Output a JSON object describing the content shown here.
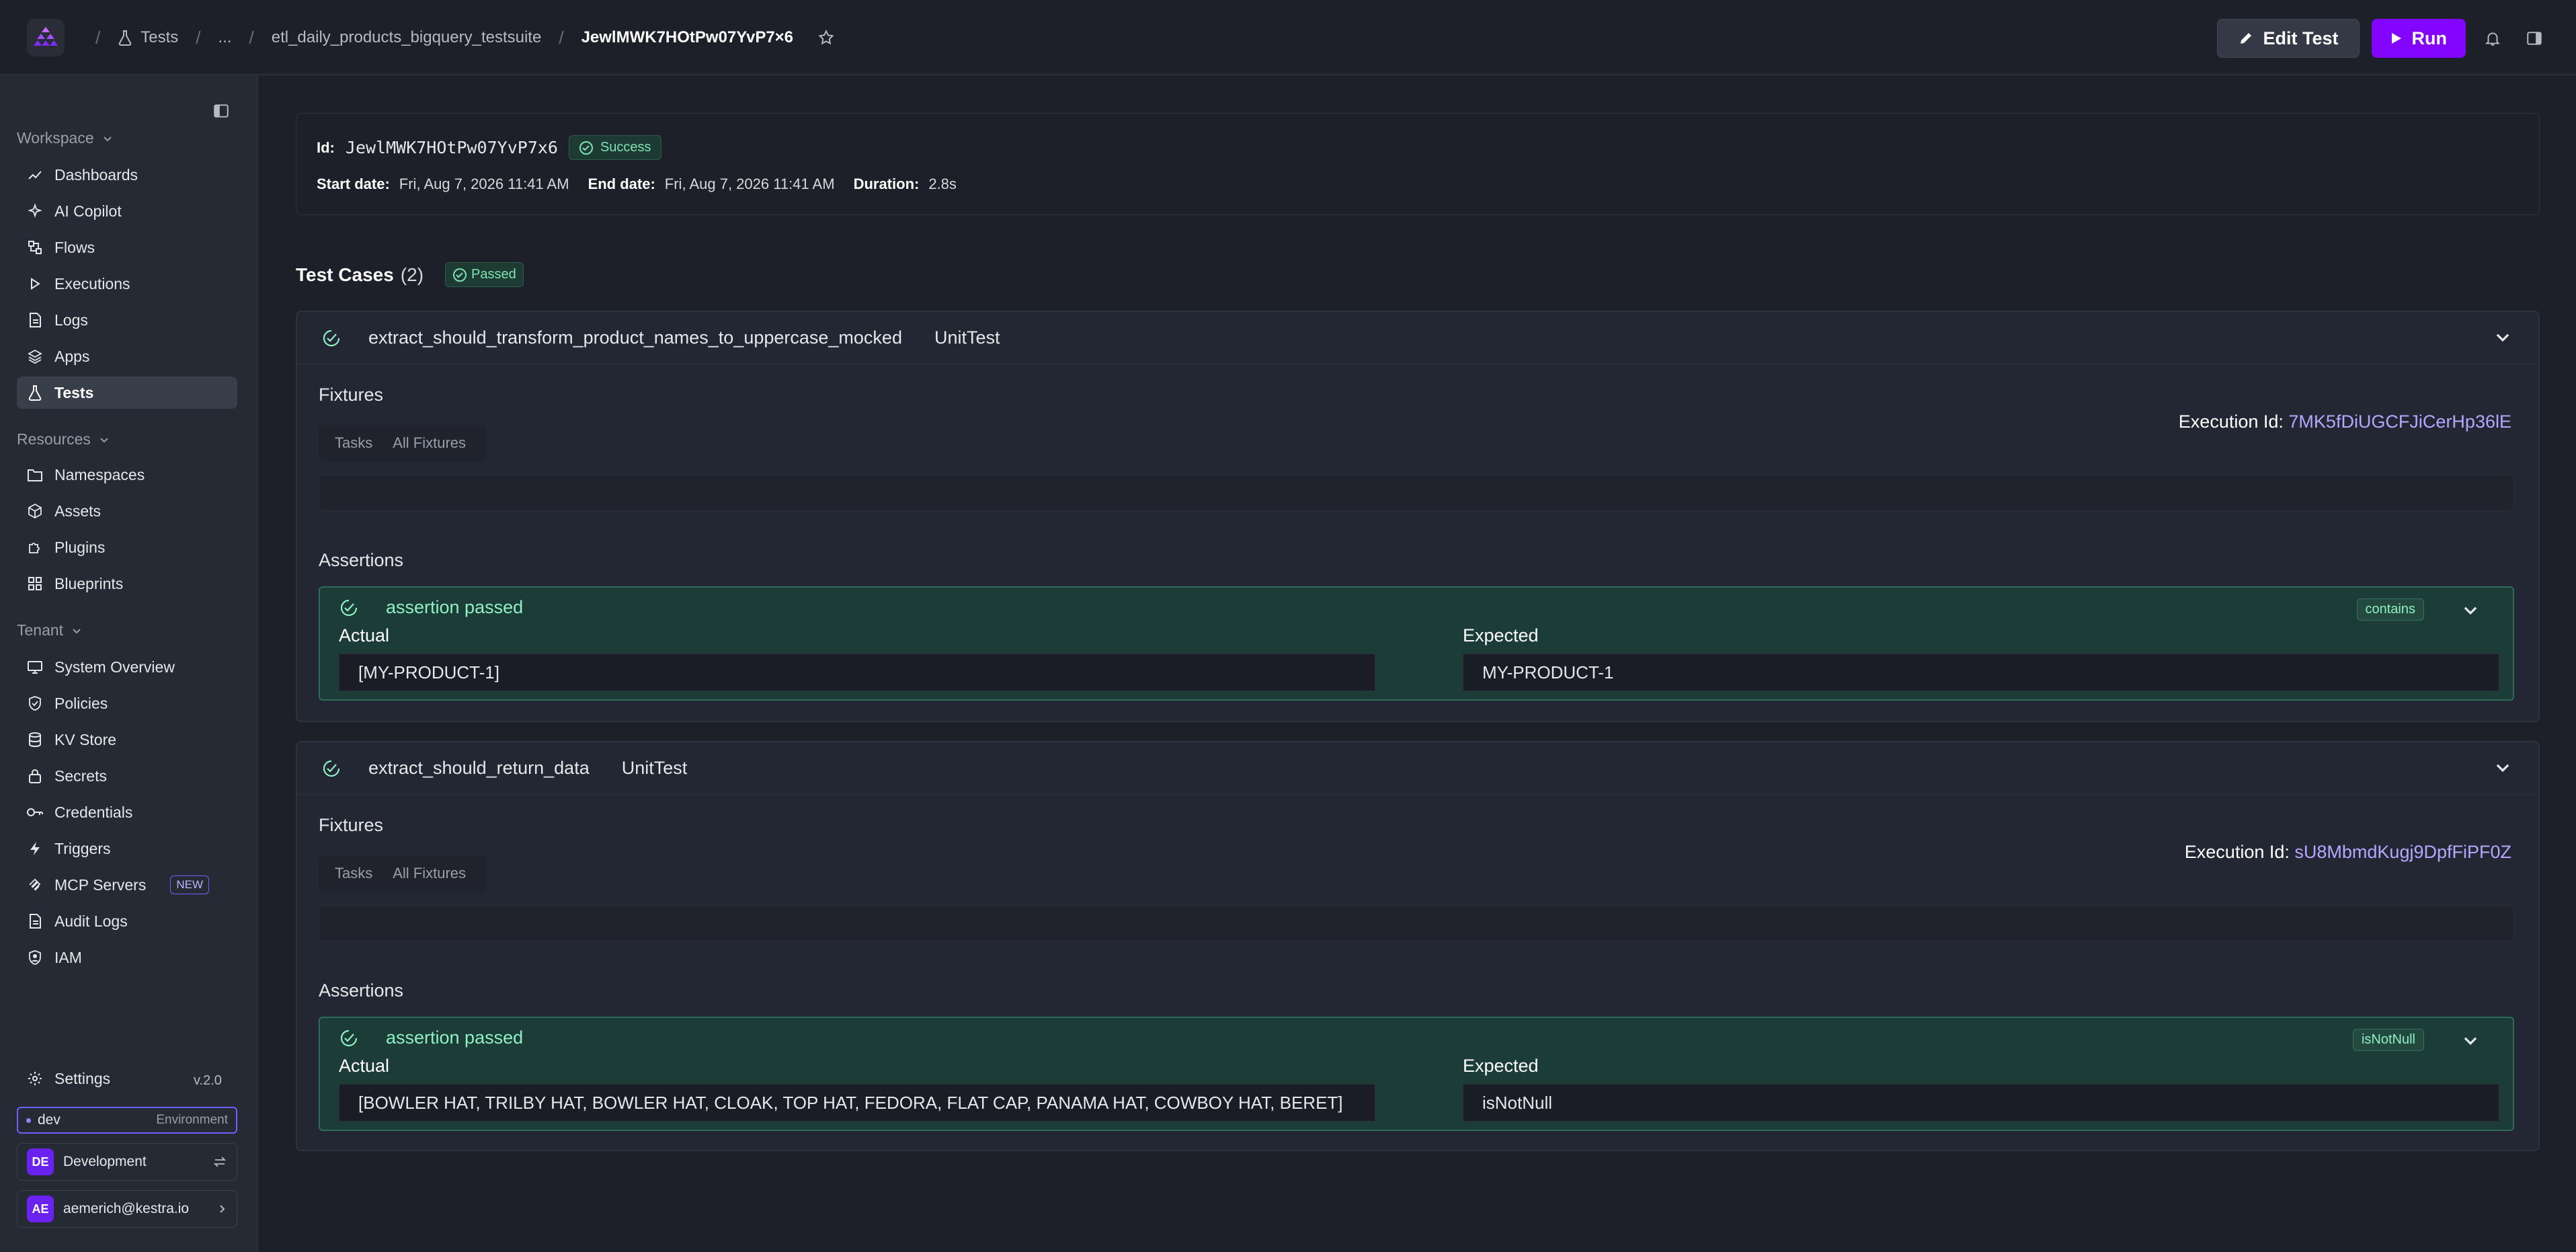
{
  "topbar": {
    "breadcrumb": {
      "tests": "Tests",
      "ellipsis": "...",
      "suite": "etl_daily_products_bigquery_testsuite",
      "current": "JewlMWK7HOtPw07YvP7×6"
    },
    "edit_label": "Edit Test",
    "run_label": "Run"
  },
  "sidebar": {
    "workspace_label": "Workspace",
    "workspace_items": [
      {
        "label": "Dashboards",
        "icon": "chart-line-icon"
      },
      {
        "label": "AI Copilot",
        "icon": "sparkle-icon"
      },
      {
        "label": "Flows",
        "icon": "flow-icon"
      },
      {
        "label": "Executions",
        "icon": "play-icon"
      },
      {
        "label": "Logs",
        "icon": "file-text-icon"
      },
      {
        "label": "Apps",
        "icon": "layers-icon"
      },
      {
        "label": "Tests",
        "icon": "flask-icon",
        "active": true
      }
    ],
    "resources_label": "Resources",
    "resources_items": [
      {
        "label": "Namespaces",
        "icon": "folder-icon"
      },
      {
        "label": "Assets",
        "icon": "cube-icon"
      },
      {
        "label": "Plugins",
        "icon": "puzzle-icon"
      },
      {
        "label": "Blueprints",
        "icon": "grid-icon"
      }
    ],
    "tenant_label": "Tenant",
    "tenant_items": [
      {
        "label": "System Overview",
        "icon": "monitor-icon"
      },
      {
        "label": "Policies",
        "icon": "shield-icon"
      },
      {
        "label": "KV Store",
        "icon": "database-icon"
      },
      {
        "label": "Secrets",
        "icon": "lock-icon"
      },
      {
        "label": "Credentials",
        "icon": "key-icon"
      },
      {
        "label": "Triggers",
        "icon": "bolt-icon"
      },
      {
        "label": "MCP Servers",
        "icon": "mcp-icon",
        "badge": "NEW"
      },
      {
        "label": "Audit Logs",
        "icon": "file-text-icon"
      },
      {
        "label": "IAM",
        "icon": "user-shield-icon"
      }
    ],
    "settings_label": "Settings",
    "version": "v.2.0",
    "env": {
      "name": "dev",
      "label": "Environment"
    },
    "tenant_card": {
      "initials": "DE",
      "name": "Development"
    },
    "user_card": {
      "initials": "AE",
      "email": "aemerich@kestra.io"
    }
  },
  "info": {
    "id_label": "Id:",
    "id_value": "JewlMWK7HOtPw07YvP7x6",
    "status": "Success",
    "start_label": "Start date:",
    "start_value": "Fri, Aug 7, 2026 11:41 AM",
    "end_label": "End date:",
    "end_value": "Fri, Aug 7, 2026 11:41 AM",
    "duration_label": "Duration:",
    "duration_value": "2.8s"
  },
  "test_cases": {
    "title": "Test Cases",
    "count": "(2)",
    "status": "Passed",
    "cases": [
      {
        "name": "extract_should_transform_product_names_to_uppercase_mocked",
        "type": "UnitTest",
        "fixtures_label": "Fixtures",
        "tab_tasks": "Tasks",
        "tab_all": "All Fixtures",
        "execution_label": "Execution Id:",
        "execution_id": "7MK5fDiUGCFJiCerHp36lE",
        "assertions_label": "Assertions",
        "assertion": {
          "status": "assertion passed",
          "operator": "contains",
          "actual_label": "Actual",
          "actual": "[MY-PRODUCT-1]",
          "expected_label": "Expected",
          "expected": "MY-PRODUCT-1"
        }
      },
      {
        "name": "extract_should_return_data",
        "type": "UnitTest",
        "fixtures_label": "Fixtures",
        "tab_tasks": "Tasks",
        "tab_all": "All Fixtures",
        "execution_label": "Execution Id:",
        "execution_id": "sU8MbmdKugj9DpfFiPF0Z",
        "assertions_label": "Assertions",
        "assertion": {
          "status": "assertion passed",
          "operator": "isNotNull",
          "actual_label": "Actual",
          "actual": "[BOWLER HAT, TRILBY HAT, BOWLER HAT, CLOAK, TOP HAT, FEDORA, FLAT CAP, PANAMA HAT, COWBOY HAT, BERET]",
          "expected_label": "Expected",
          "expected": "isNotNull"
        }
      }
    ]
  },
  "colors": {
    "accent": "#8405ff",
    "success": "#7fe3b5",
    "assert_bg": "#1c3c37"
  }
}
